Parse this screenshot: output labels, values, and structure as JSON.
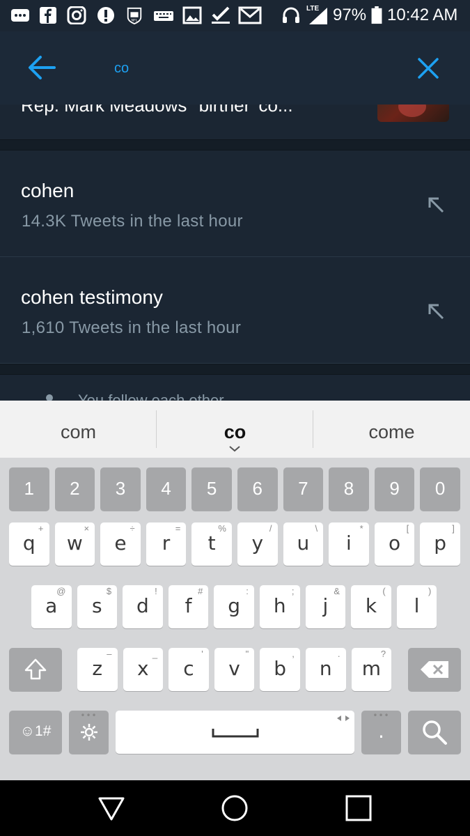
{
  "status_bar": {
    "battery": "97%",
    "time": "10:42 AM",
    "network": "LTE",
    "icons": [
      "message-icon",
      "facebook-icon",
      "instagram-icon",
      "alert-icon",
      "nfl-icon",
      "keyboard-icon",
      "image-icon",
      "check-icon",
      "gmail-icon",
      "headset-icon",
      "signal-icon",
      "battery-icon"
    ]
  },
  "search": {
    "query": "co"
  },
  "results": {
    "partial_tweet": "Rep. Mark Meadows' 'birther' co...",
    "suggestions": [
      {
        "title": "cohen",
        "subtitle": "14.3K Tweets in the last hour"
      },
      {
        "title": "cohen testimony",
        "subtitle": "1,610 Tweets in the last hour"
      }
    ],
    "people_hint": "You follow each other"
  },
  "keyboard": {
    "suggestions": [
      "com",
      "co",
      "come"
    ],
    "number_row": [
      "1",
      "2",
      "3",
      "4",
      "5",
      "6",
      "7",
      "8",
      "9",
      "0"
    ],
    "row1": [
      {
        "k": "q",
        "h": "+"
      },
      {
        "k": "w",
        "h": "×"
      },
      {
        "k": "e",
        "h": "÷"
      },
      {
        "k": "r",
        "h": "="
      },
      {
        "k": "t",
        "h": "%"
      },
      {
        "k": "y",
        "h": "/"
      },
      {
        "k": "u",
        "h": "\\"
      },
      {
        "k": "i",
        "h": "*"
      },
      {
        "k": "o",
        "h": "["
      },
      {
        "k": "p",
        "h": "]"
      }
    ],
    "row2": [
      {
        "k": "a",
        "h": "@"
      },
      {
        "k": "s",
        "h": "$"
      },
      {
        "k": "d",
        "h": "!"
      },
      {
        "k": "f",
        "h": "#"
      },
      {
        "k": "g",
        "h": ":"
      },
      {
        "k": "h",
        "h": ";"
      },
      {
        "k": "j",
        "h": "&"
      },
      {
        "k": "k",
        "h": "("
      },
      {
        "k": "l",
        "h": ")"
      }
    ],
    "row3": [
      {
        "k": "z",
        "h": "–"
      },
      {
        "k": "x",
        "h": "_"
      },
      {
        "k": "c",
        "h": "'"
      },
      {
        "k": "v",
        "h": "\""
      },
      {
        "k": "b",
        "h": ","
      },
      {
        "k": "n",
        "h": "."
      },
      {
        "k": "m",
        "h": "?"
      }
    ],
    "symbols_label": "☺1#",
    "period_label": "."
  },
  "colors": {
    "accent": "#1da1f2",
    "background": "#1b2633",
    "secondary_text": "#8899a6"
  }
}
